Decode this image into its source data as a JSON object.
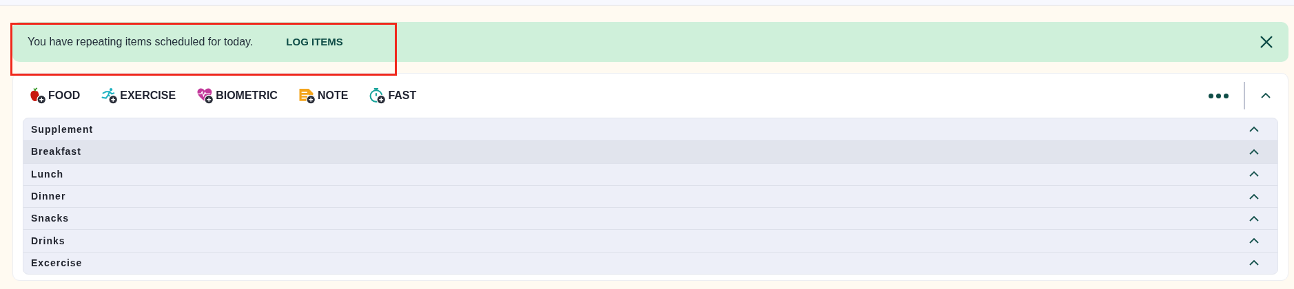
{
  "banner": {
    "message": "You have repeating items scheduled for today.",
    "action": "LOG ITEMS",
    "highlighted": true
  },
  "toolbar": {
    "items": [
      {
        "kind": "food",
        "label": "FOOD"
      },
      {
        "kind": "exercise",
        "label": "EXERCISE"
      },
      {
        "kind": "biometric",
        "label": "BIOMETRIC"
      },
      {
        "kind": "note",
        "label": "NOTE"
      },
      {
        "kind": "fast",
        "label": "FAST"
      }
    ],
    "expanded": true
  },
  "meals": [
    {
      "name": "Supplement",
      "selected": false,
      "expanded": true
    },
    {
      "name": "Breakfast",
      "selected": true,
      "expanded": true
    },
    {
      "name": "Lunch",
      "selected": false,
      "expanded": true
    },
    {
      "name": "Dinner",
      "selected": false,
      "expanded": true
    },
    {
      "name": "Snacks",
      "selected": false,
      "expanded": true
    },
    {
      "name": "Drinks",
      "selected": false,
      "expanded": true
    },
    {
      "name": "Excercise",
      "selected": false,
      "expanded": true
    }
  ]
}
